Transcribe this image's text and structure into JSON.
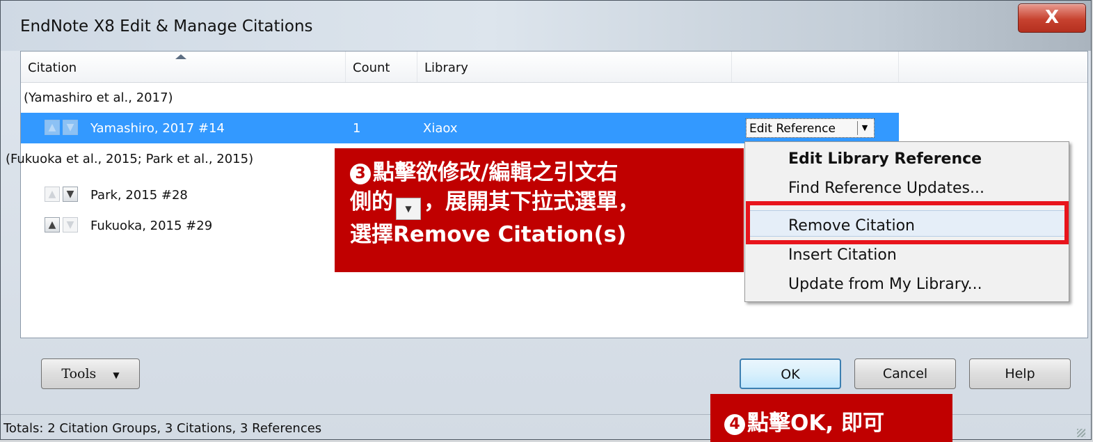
{
  "window": {
    "title": "EndNote X8 Edit & Manage Citations",
    "close_label": "X"
  },
  "columns": {
    "citation": "Citation",
    "count": "Count",
    "library": "Library"
  },
  "groups": [
    {
      "label": "(Yamashiro et al., 2017)",
      "items": [
        {
          "citation": "Yamashiro, 2017 #14",
          "count": "1",
          "library": "Xiaox"
        }
      ]
    },
    {
      "label": "(Fukuoka et al., 2015; Park et al., 2015)",
      "items": [
        {
          "citation": "Park, 2015 #28"
        },
        {
          "citation": "Fukuoka, 2015 #29"
        }
      ]
    }
  ],
  "edit_reference": {
    "label": "Edit Reference"
  },
  "context_menu": {
    "items": [
      "Edit Library Reference",
      "Find Reference Updates...",
      "Remove Citation",
      "Insert Citation",
      "Update from My Library..."
    ]
  },
  "callout_step3": {
    "number": "3",
    "line1": "點擊欲修改/編輯之引文右",
    "line2a": "側的",
    "line2b": "，展開其下拉式選單，",
    "line3": "選擇Remove Citation(s)"
  },
  "buttons": {
    "tools": "Tools",
    "ok": "OK",
    "cancel": "Cancel",
    "help": "Help"
  },
  "status": {
    "text": "Totals: 2 Citation Groups, 3 Citations, 3 References"
  },
  "callout_step4": {
    "number": "4",
    "text": "點擊OK, 即可"
  },
  "colors": {
    "selection": "#3399ff",
    "callout": "#c00000",
    "highlight_border": "#e8141c"
  }
}
